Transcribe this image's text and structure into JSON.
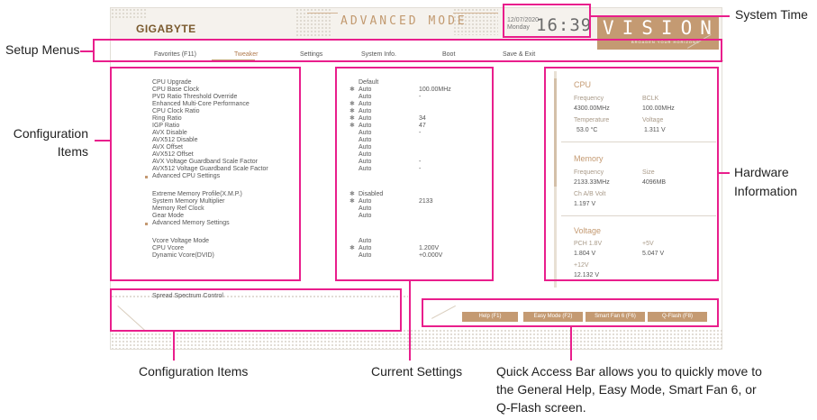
{
  "bios": {
    "brand": "GIGABYTE",
    "mode_title": "ADVANCED MODE",
    "date": "12/07/2020",
    "day": "Monday",
    "time": "16:39",
    "vision_title": "VISION",
    "vision_subtitle": "BROADEN YOUR HORIZONS"
  },
  "menu": {
    "tabs": [
      {
        "label": "Favorites (F11)"
      },
      {
        "label": "Tweaker"
      },
      {
        "label": "Settings"
      },
      {
        "label": "System Info."
      },
      {
        "label": "Boot"
      },
      {
        "label": "Save & Exit"
      }
    ],
    "active_tab": "Tweaker"
  },
  "config": {
    "items": [
      "CPU Upgrade",
      "CPU Base Clock",
      "PVD Ratio Threshold Override",
      "Enhanced Multi-Core Performance",
      "CPU Clock Ratio",
      "Ring Ratio",
      "IGP Ratio",
      "AVX Disable",
      "AVX512 Disable",
      "AVX Offset",
      "AVX512 Offset",
      "AVX Voltage Guardband Scale Factor",
      "AVX512 Voltage Guardband Scale Factor",
      "Advanced CPU Settings",
      "Extreme Memory Profile(X.M.P.)",
      "System Memory Multiplier",
      "Memory Ref Clock",
      "Gear Mode",
      "Advanced Memory Settings",
      "Vcore Voltage Mode",
      "CPU Vcore",
      "Dynamic Vcore(DVID)"
    ],
    "values": [
      "Default",
      "Auto",
      "Auto",
      "Auto",
      "Auto",
      "Auto",
      "Auto",
      "Auto",
      "Auto",
      "Auto",
      "Auto",
      "Auto",
      "Auto",
      "Disabled",
      "Auto",
      "Auto",
      "Auto",
      "Auto",
      "Auto",
      "Auto"
    ],
    "current": [
      "100.00MHz",
      "-",
      "34",
      "47",
      "-",
      "-",
      "-",
      "2133",
      "1.200V",
      "+0.000V"
    ],
    "help_item": "Spread Spectrum Control"
  },
  "hardware": {
    "cpu": {
      "title": "CPU",
      "freq_label": "Frequency",
      "freq": "4300.00MHz",
      "bclk_label": "BCLK",
      "bclk": "100.00MHz",
      "temp_label": "Temperature",
      "temp": "53.0 °C",
      "volt_label": "Voltage",
      "volt": "1.311 V"
    },
    "memory": {
      "title": "Memory",
      "freq_label": "Frequency",
      "freq": "2133.33MHz",
      "size_label": "Size",
      "size": "4096MB",
      "chab_label": "Ch A/B Volt",
      "chab": "1.197 V"
    },
    "voltage": {
      "title": "Voltage",
      "pch_label": "PCH 1.8V",
      "pch": "1.804 V",
      "p5_label": "+5V",
      "p5": "5.047 V",
      "p12_label": "+12V",
      "p12": "12.132 V"
    }
  },
  "quick_access": {
    "buttons": [
      "Help (F1)",
      "Easy Mode (F2)",
      "Smart Fan 6 (F6)",
      "Q-Flash (F8)"
    ]
  },
  "annotations": {
    "system_time": "System Time",
    "setup_menus": "Setup Menus",
    "config_line1": "Configuration",
    "config_line2": "Items",
    "hw_line1": "Hardware",
    "hw_line2": "Information",
    "config_bottom": "Configuration Items",
    "current_settings": "Current Settings",
    "qa_line1": "Quick Access Bar allows you to quickly move to",
    "qa_line2": "the General Help, Easy Mode, Smart Fan 6, or",
    "qa_line3": "Q-Flash screen."
  },
  "colors": {
    "annotation": "#e91e8c",
    "accent": "#c49a72"
  }
}
